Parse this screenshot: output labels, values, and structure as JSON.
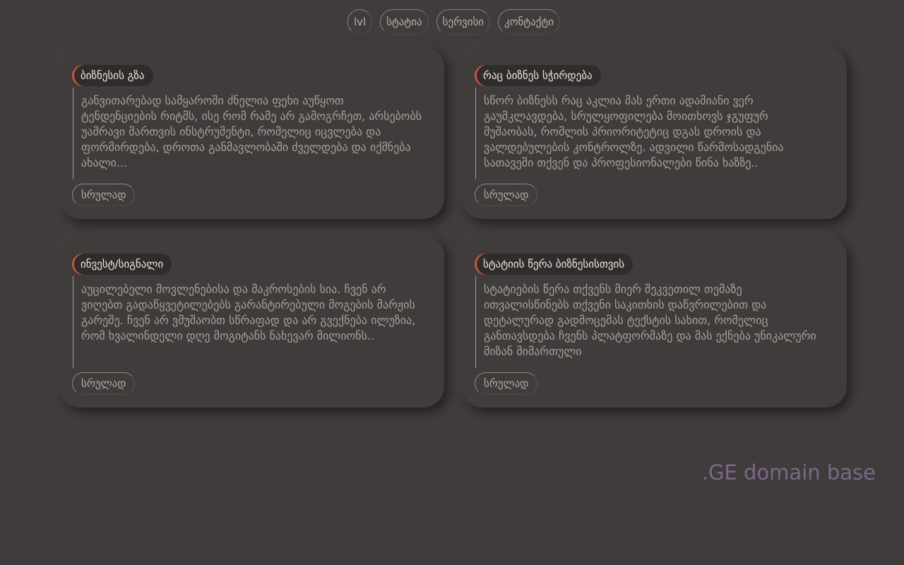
{
  "nav": {
    "items": [
      {
        "label": "lvl"
      },
      {
        "label": "სტატია"
      },
      {
        "label": "სერვისი"
      },
      {
        "label": "კონტაქტი"
      }
    ]
  },
  "cards": [
    {
      "title": "ბიზნესის გზა",
      "text": "განვითარებად სამყაროში ძნელია ფეხი აუწყოთ ტენდენციების რიტმს, ისე რომ რამე არ გამოგრჩეთ, არსებობს უამრავი მართვის ინსტრუმენტი, რომელიც იცვლება და ფორმირდება, დროთა განმავლობაში ძველდება და იქმნება ახალი...",
      "more_label": "სრულად"
    },
    {
      "title": "რაც ბიზნეს სჭირდება",
      "text": "სწორ ბიზნესს რაც აკლია მას ერთი ადამიანი ვერ გაუმკლავდება, სრულყოფილება მოითხოვს ჯგუფურ მუშაობას, რომლის პრიორიტეტიც დგას დროის და ვალდებულების კონტროლზე. ადვილი წარმოსადგენია სათავეში თქვენ და პროფესიონალები წინა ხაზზე..",
      "more_label": "სრულად"
    },
    {
      "title": "ინვესტ/სიგნალი",
      "text": "აუცილებელი მოვლენებისა და მაკროსების სია. ჩვენ არ ვიღებთ გადაწყვეტილებებს გარანტირებული მოგების მარჟის გარეშე. ჩვენ არ ვმუშაობთ სწრაფად და არ გვექნება ილუზია, რომ ხვალინდელი დღე მოგიტანს ნახევარ მილიონს..",
      "more_label": "სრულად"
    },
    {
      "title": "სტატიის წერა ბიზნესისთვის",
      "text": "სტატიების წერა თქვენს მიერ შეკვეთილ თემაზე ითვალისწინებს თქვენი საკითხის დაწვრილებით და დეტალურად გადმოცემას ტექსტის სახით, რომელიც განთავსდება ჩვენს პლატფორმაზე და მას ექნება უნიკალური მიზან მიმართული",
      "more_label": "სრულად"
    }
  ],
  "brand": ".GE domain base"
}
